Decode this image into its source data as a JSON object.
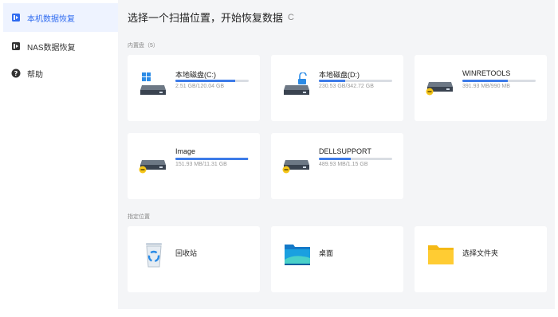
{
  "sidebar": {
    "items": [
      {
        "label": "本机数据恢复",
        "icon": "local-recovery-icon",
        "active": true
      },
      {
        "label": "NAS数据恢复",
        "icon": "nas-recovery-icon",
        "active": false
      },
      {
        "label": "帮助",
        "icon": "help-icon",
        "active": false
      }
    ]
  },
  "main": {
    "title": "选择一个扫描位置，开始恢复数据",
    "refresh_glyph": "C",
    "drives_section": "内置盘（5）",
    "drives": [
      {
        "name": "本地磁盘(C:)",
        "size": "2.51 GB/120.04 GB",
        "used": 0.81,
        "icon": "windows-system-drive-icon"
      },
      {
        "name": "本地磁盘(D:)",
        "size": "230.53 GB/342.72 GB",
        "used": 0.36,
        "icon": "drive-unlocked-icon"
      },
      {
        "name": "WINRETOOLS",
        "size": "391.93 MB/990 MB",
        "used": 0.62,
        "icon": "drive-warning-icon"
      },
      {
        "name": "Image",
        "size": "151.93 MB/11.31 GB",
        "used": 0.99,
        "icon": "drive-warning-icon"
      },
      {
        "name": "DELLSUPPORT",
        "size": "489.93 MB/1.15 GB",
        "used": 0.44,
        "icon": "drive-warning-icon"
      }
    ],
    "locations_section": "指定位置",
    "locations": [
      {
        "name": "回收站",
        "icon": "recycle-bin-icon"
      },
      {
        "name": "桌面",
        "icon": "desktop-icon"
      },
      {
        "name": "选择文件夹",
        "icon": "folder-icon"
      }
    ]
  },
  "colors": {
    "accent": "#2f6bf0",
    "bar": "#3d7be8",
    "background": "#f4f5f7"
  }
}
